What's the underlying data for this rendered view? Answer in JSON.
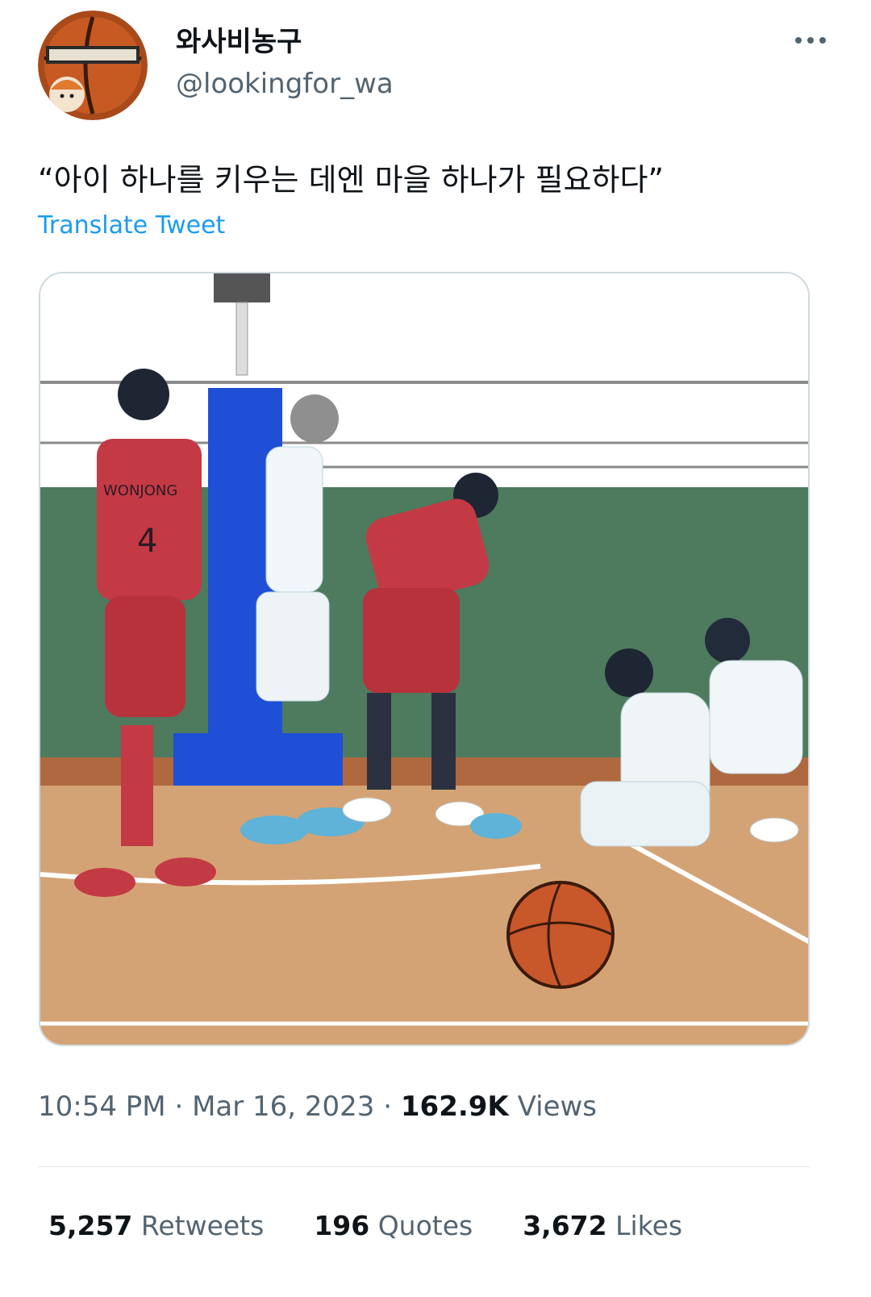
{
  "user": {
    "display_name": "와사비농구",
    "handle": "@lookingfor_wa"
  },
  "tweet": {
    "text": "“아이 하나를 키우는 데엔 마을 하나가 필요하다”",
    "translate_label": "Translate Tweet",
    "time": "10:54 PM",
    "separator": "·",
    "date": "Mar 16, 2023",
    "views_count": "162.9K",
    "views_label": "Views"
  },
  "stats": {
    "retweets_count": "5,257",
    "retweets_label": "Retweets",
    "quotes_count": "196",
    "quotes_label": "Quotes",
    "likes_count": "3,672",
    "likes_label": "Likes"
  },
  "media": {
    "alt": "basketball-manga-panel",
    "jersey_text": "WONJONG",
    "jersey_number": "4"
  },
  "icons": {
    "more": "more-dots-icon"
  },
  "colors": {
    "link": "#1d9bf0",
    "secondary_text": "#536471",
    "primary_text": "#0f1419"
  }
}
